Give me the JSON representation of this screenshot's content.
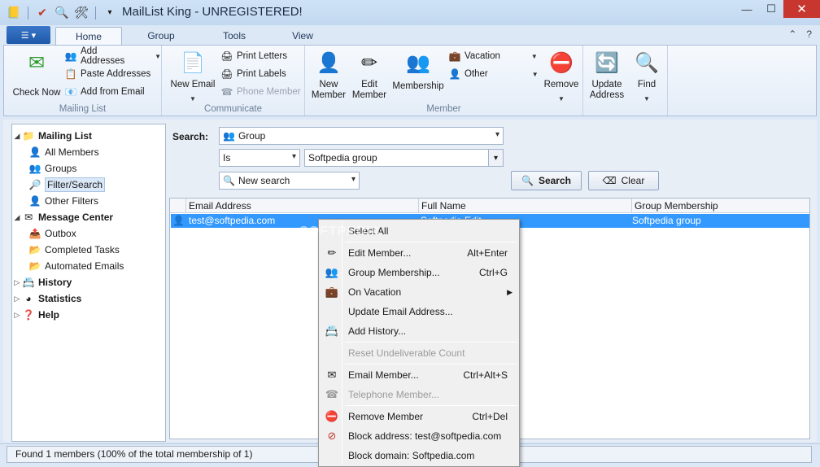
{
  "window": {
    "title": "MailList King - UNREGISTERED!"
  },
  "quick_access": {
    "icons": [
      "app-icon",
      "checkmark-icon",
      "find-icon",
      "tools-icon"
    ]
  },
  "tabs": [
    {
      "label": "Home",
      "active": true
    },
    {
      "label": "Group"
    },
    {
      "label": "Tools"
    },
    {
      "label": "View"
    }
  ],
  "ribbon": {
    "mailing_list": {
      "label": "Mailing List",
      "check_now": "Check Now",
      "add_addresses": "Add Addresses",
      "paste_addresses": "Paste Addresses",
      "add_from_email": "Add from Email"
    },
    "communicate": {
      "label": "Communicate",
      "new_email": "New Email",
      "print_letters": "Print Letters",
      "print_labels": "Print Labels",
      "phone_member": "Phone Member"
    },
    "member": {
      "label": "Member",
      "new_member_l1": "New",
      "new_member_l2": "Member",
      "edit_member_l1": "Edit",
      "edit_member_l2": "Member",
      "membership": "Membership",
      "vacation": "Vacation",
      "other": "Other",
      "remove": "Remove",
      "update_address_l1": "Update",
      "update_address_l2": "Address",
      "find": "Find"
    }
  },
  "tree": {
    "mailing_list": "Mailing List",
    "all_members": "All Members",
    "groups": "Groups",
    "filter_search": "Filter/Search",
    "other_filters": "Other Filters",
    "message_center": "Message Center",
    "outbox": "Outbox",
    "completed_tasks": "Completed Tasks",
    "automated_emails": "Automated Emails",
    "history": "History",
    "statistics": "Statistics",
    "help": "Help"
  },
  "search": {
    "label": "Search:",
    "field": "Group",
    "operator": "Is",
    "value": "Softpedia group",
    "saved": "New search",
    "search_button": "Search",
    "clear_button": "Clear"
  },
  "grid": {
    "columns": [
      "Email Address",
      "Full Name",
      "Group Membership"
    ],
    "rows": [
      {
        "email": "test@softpedia.com",
        "name": "Softpedia Edit",
        "group": "Softpedia group"
      }
    ]
  },
  "status": {
    "text": "Found 1 members (100% of the total membership of 1)"
  },
  "context_menu": {
    "select_all": "Select All",
    "edit_member": "Edit Member...",
    "edit_member_shortcut": "Alt+Enter",
    "group_membership": "Group Membership...",
    "group_membership_shortcut": "Ctrl+G",
    "on_vacation": "On Vacation",
    "update_email": "Update Email Address...",
    "add_history": "Add History...",
    "reset_undeliverable": "Reset Undeliverable Count",
    "email_member": "Email Member...",
    "email_member_shortcut": "Ctrl+Alt+S",
    "telephone_member": "Telephone Member...",
    "remove_member": "Remove Member",
    "remove_member_shortcut": "Ctrl+Del",
    "block_address": "Block address: test@softpedia.com",
    "block_domain": "Block domain: Softpedia.com"
  },
  "watermark": "SOFTPEDIA",
  "colors": {
    "selection": "#3399ff",
    "close_button": "#c7372f",
    "file_button": "#1f58a8"
  }
}
